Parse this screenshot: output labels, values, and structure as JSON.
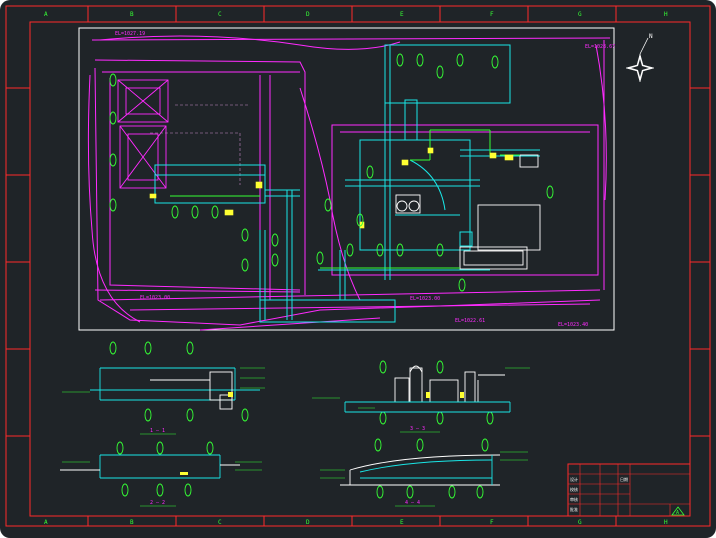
{
  "colors": {
    "background": "#1f2428",
    "border": "#ff2a2a",
    "plan_frame": "#ffffff",
    "magenta": "#ff2bff",
    "cyan": "#19e6e6",
    "green": "#35ff35",
    "yellow": "#ffff33",
    "white": "#ffffff"
  },
  "border_letters": [
    "A",
    "B",
    "C",
    "D",
    "E",
    "F",
    "G",
    "H"
  ],
  "border_numbers": [
    "1",
    "2",
    "3",
    "4",
    "5",
    "6",
    "7",
    "8"
  ],
  "north_arrow_label": "N",
  "elevations": {
    "top_left": "EL=1027.19",
    "top_right": "EL=1028.67",
    "bottom_left": "EL=1023.00",
    "bottom_mid": "EL=1023.00",
    "bottom_right": "EL=1023.40",
    "bottom_right2": "EL=1022.61"
  },
  "section_labels": {
    "s1": "1 — 1",
    "s2": "2 — 2",
    "s3": "3 — 3",
    "s4": "4 — 4"
  },
  "title_block": {
    "row_labels": [
      "设计",
      "校核",
      "审核",
      "批准",
      "日期"
    ],
    "logo_mark": "A"
  }
}
